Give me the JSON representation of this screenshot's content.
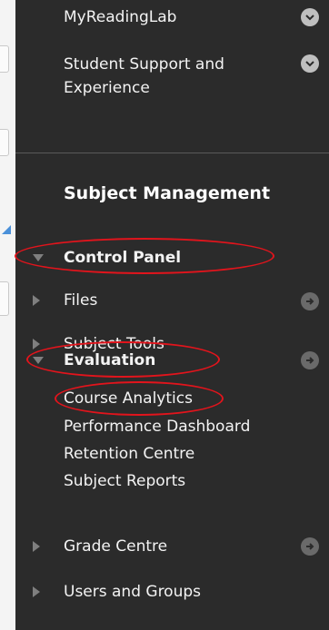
{
  "menu_top": {
    "myreadinglab": "MyReadingLab",
    "student_support_line1": "Student Support and",
    "student_support_line2": "Experience"
  },
  "subject_management": {
    "heading": "Subject Management",
    "control_panel": "Control Panel",
    "files": "Files",
    "subject_tools": "Subject Tools",
    "evaluation": "Evaluation",
    "evaluation_items": [
      "Course Analytics",
      "Performance Dashboard",
      "Retention Centre",
      "Subject Reports"
    ],
    "grade_centre": "Grade Centre",
    "users_and_groups": "Users and Groups"
  },
  "colors": {
    "panel": "#2b2b2b",
    "annotation": "#e2141c"
  }
}
